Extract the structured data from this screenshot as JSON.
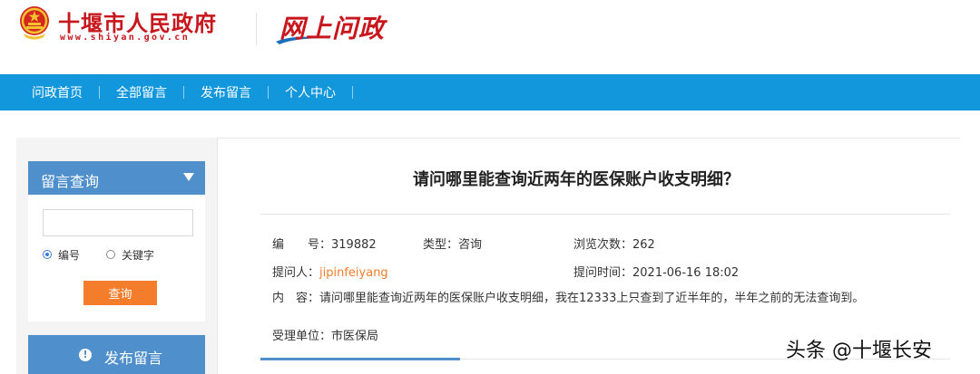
{
  "header": {
    "site_name": "十堰市人民政府",
    "site_url": "www.shiyan.gov.cn",
    "module_logo": "网上问政",
    "colors": {
      "brand_red": "#c8161d",
      "logo_blue": "#1a6fb8"
    }
  },
  "nav": {
    "items": [
      {
        "label": "问政首页"
      },
      {
        "label": "全部留言"
      },
      {
        "label": "发布留言"
      },
      {
        "label": "个人中心"
      }
    ],
    "color": "#1397dc"
  },
  "sidebar": {
    "search_panel": {
      "title": "留言查询",
      "input_value": "",
      "options": [
        {
          "label": "编号",
          "checked": true
        },
        {
          "label": "关键字",
          "checked": false
        }
      ],
      "button_label": "查询"
    },
    "publish_button": {
      "label": "发布留言",
      "icon": "info-icon"
    },
    "colors": {
      "panel_blue": "#4f8fcb",
      "button_orange": "#f47d2c"
    }
  },
  "message": {
    "title": "请问哪里能查询近两年的医保账户收支明细？",
    "id_label": "编　　号：",
    "id_value": "319882",
    "type_label": "类型：",
    "type_value": "咨询",
    "views_label": "浏览次数：",
    "views_value": "262",
    "asker_label": "提问人：",
    "asker_value": "jipinfeiyang",
    "time_label": "提问时间：",
    "time_value": "2021-06-16 18:02",
    "content_label": "内　容：",
    "content_value": "请问哪里能查询近两年的医保账户收支明细，我在12333上只查到了近半年的，半年之前的无法查询到。",
    "dept_label": "受理单位：",
    "dept_value": "市医保局"
  },
  "watermark": "头条 @十堰长安"
}
